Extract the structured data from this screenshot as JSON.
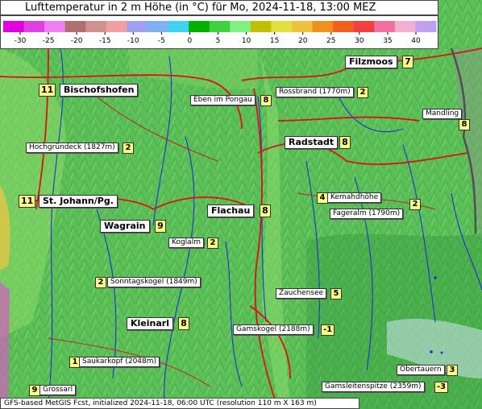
{
  "title": "Lufttemperatur in 2 m Höhe (in °C) für Mo, 2024-11-18, 13:00 MEZ",
  "legend": {
    "ticks": [
      "-30",
      "-25",
      "-20",
      "-15",
      "-10",
      "-5",
      "0",
      "5",
      "10",
      "15",
      "20",
      "25",
      "30",
      "35",
      "40"
    ],
    "colors": [
      "#e000e0",
      "#e040e0",
      "#f080f0",
      "#b07070",
      "#d09090",
      "#f0a0a0",
      "#a0a0f0",
      "#80b0f0",
      "#40d0f0",
      "#00b000",
      "#40d040",
      "#80f080",
      "#c0c000",
      "#e0e040",
      "#f0c040",
      "#f09020",
      "#f06020",
      "#f04040",
      "#f070a0",
      "#f0b0d0",
      "#c0a0f0"
    ]
  },
  "places": [
    {
      "name": "Filzmoos",
      "value": "7"
    },
    {
      "name": "Bischofshofen",
      "value": "11"
    },
    {
      "name": "Rossbrand (1770m)",
      "value": "2"
    },
    {
      "name": "Eben im Pongau",
      "value": "8"
    },
    {
      "name": "Mandling",
      "value": "8"
    },
    {
      "name": "Radstadt",
      "value": "8"
    },
    {
      "name": "Hochgründeck (1827m)",
      "value": "2"
    },
    {
      "name": "St. Johann/Pg.",
      "value": "11"
    },
    {
      "name": "Kemahdhöhe",
      "value": "4"
    },
    {
      "name": "Fageralm (1790m)",
      "value": "2"
    },
    {
      "name": "Flachau",
      "value": "8"
    },
    {
      "name": "Wagrain",
      "value": "9"
    },
    {
      "name": "Koglalm",
      "value": "2"
    },
    {
      "name": "Sonntagskogel (1849m)",
      "value": "2"
    },
    {
      "name": "Zauchensee",
      "value": "5"
    },
    {
      "name": "Kleinarl",
      "value": "8"
    },
    {
      "name": "Gamskogel (2188m)",
      "value": "-1"
    },
    {
      "name": "Saukarkopf (2048m)",
      "value": "1"
    },
    {
      "name": "Obertauern",
      "value": "3"
    },
    {
      "name": "Grossarl",
      "value": "9"
    },
    {
      "name": "Gamsleitenspitze (2359m)",
      "value": "-3"
    }
  ],
  "footer": "GFS-based MetGIS Fcst, initialized 2024-11-18, 06:00 UTC  (resolution 110 m X 163 m)"
}
